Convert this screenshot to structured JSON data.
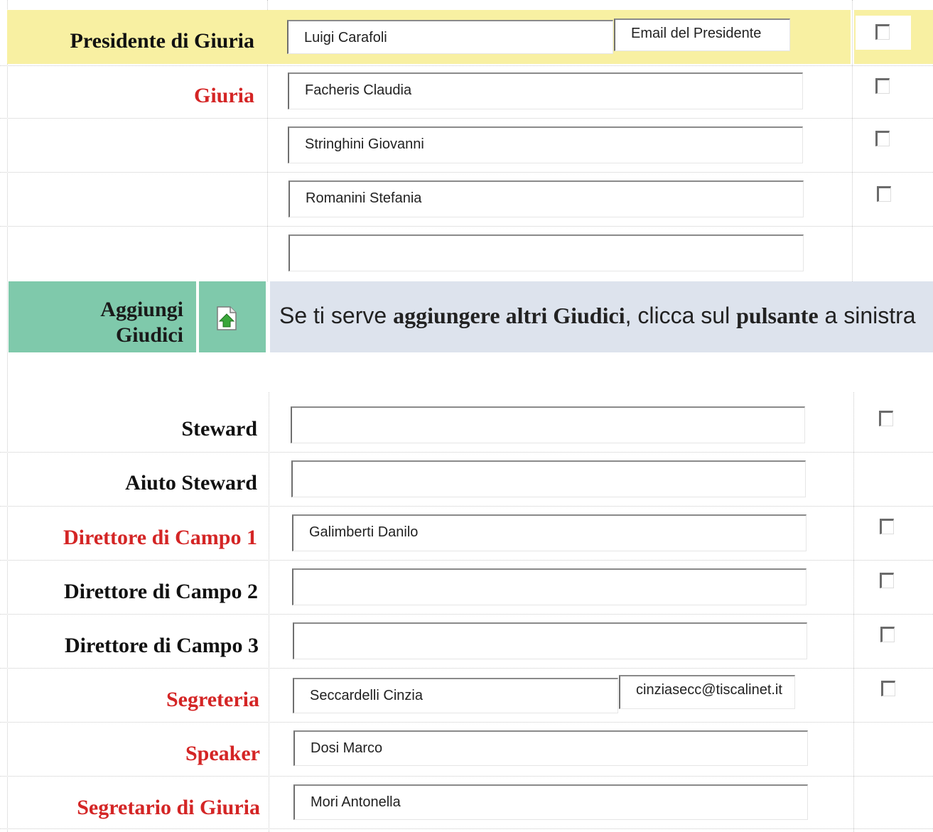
{
  "presidente": {
    "label": "Presidente di Giuria",
    "name_value": "Luigi Carafoli",
    "email_value": "Email del Presidente"
  },
  "giuria": {
    "label": "Giuria",
    "members": [
      "Facheris Claudia",
      "Stringhini Giovanni",
      "Romanini Stefania",
      ""
    ]
  },
  "aggiungi": {
    "label_line1": "Aggiungi",
    "label_line2": "Giudici",
    "info_part1": "Se ti serve ",
    "info_bold1": "aggiungere altri Giudici",
    "info_part2": ", clicca sul ",
    "info_bold2": "pulsante",
    "info_part3": " a sinistra"
  },
  "staff": {
    "steward": {
      "label": "Steward",
      "value": ""
    },
    "aiuto_steward": {
      "label": "Aiuto Steward",
      "value": ""
    },
    "direttore1": {
      "label": "Direttore di Campo 1",
      "value": "Galimberti Danilo"
    },
    "direttore2": {
      "label": "Direttore di Campo 2",
      "value": ""
    },
    "direttore3": {
      "label": "Direttore di Campo 3",
      "value": ""
    },
    "segreteria": {
      "label": "Segreteria",
      "value": "Seccardelli Cinzia",
      "email": "cinziasecc@tiscalinet.it"
    },
    "speaker": {
      "label": "Speaker",
      "value": "Dosi Marco"
    },
    "segretario": {
      "label": "Segretario di Giuria",
      "value": "Mori Antonella"
    }
  },
  "colors": {
    "required_label": "#d42525",
    "presidente_band": "#f8f0a2",
    "add_band": "#7fc9ab",
    "info_band": "#dde3ed"
  },
  "icons": {
    "add_button": "add-page-icon"
  }
}
